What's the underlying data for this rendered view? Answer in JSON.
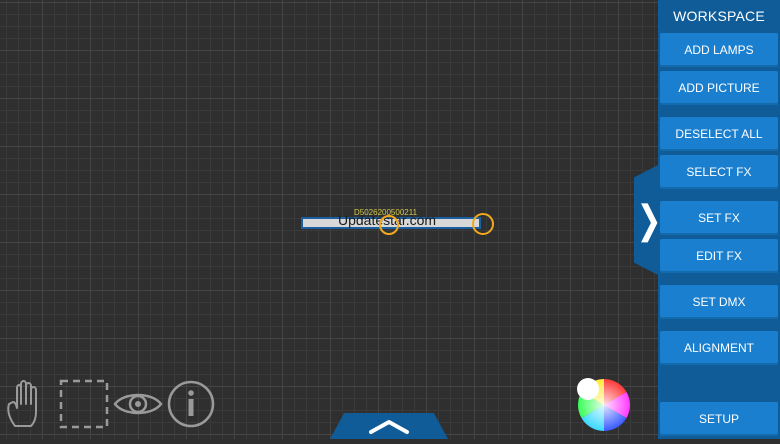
{
  "workspace": {
    "title": "WORKSPACE",
    "buttons": {
      "add_lamps": "ADD LAMPS",
      "add_picture": "ADD PICTURE",
      "deselect_all": "DESELECT ALL",
      "select_fx": "SELECT FX",
      "set_fx": "SET FX",
      "edit_fx": "EDIT FX",
      "set_dmx": "SET DMX",
      "alignment": "ALIGNMENT",
      "setup": "SETUP"
    }
  },
  "canvas": {
    "fixture": {
      "id": "D5026200500211",
      "watermark": "Updatestar.com"
    }
  },
  "toolbar": {
    "icons": [
      "hand-icon",
      "select-rectangle-icon",
      "eye-icon",
      "info-icon",
      "color-wheel-icon"
    ]
  },
  "colors": {
    "panel": "#0f5c98",
    "button": "#1b7fcf",
    "handle": "#f2a81d"
  }
}
